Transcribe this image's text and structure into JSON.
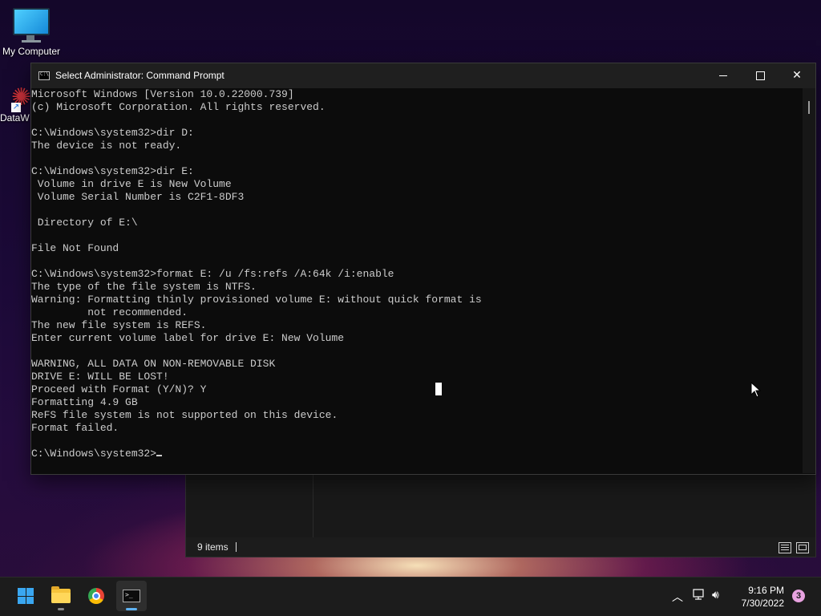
{
  "desktop": {
    "icons": [
      {
        "label": "My Computer"
      },
      {
        "label": "DataW"
      }
    ]
  },
  "explorer": {
    "status_items": "9 items"
  },
  "cmd": {
    "title": "Select Administrator: Command Prompt",
    "lines": [
      "Microsoft Windows [Version 10.0.22000.739]",
      "(c) Microsoft Corporation. All rights reserved.",
      "",
      "C:\\Windows\\system32>dir D:",
      "The device is not ready.",
      "",
      "C:\\Windows\\system32>dir E:",
      " Volume in drive E is New Volume",
      " Volume Serial Number is C2F1-8DF3",
      "",
      " Directory of E:\\",
      "",
      "File Not Found",
      "",
      "C:\\Windows\\system32>format E: /u /fs:refs /A:64k /i:enable",
      "The type of the file system is NTFS.",
      "Warning: Formatting thinly provisioned volume E: without quick format is",
      "         not recommended.",
      "The new file system is REFS.",
      "Enter current volume label for drive E: New Volume",
      "",
      "WARNING, ALL DATA ON NON-REMOVABLE DISK",
      "DRIVE E: WILL BE LOST!",
      "Proceed with Format (Y/N)? Y",
      "Formatting 4.9 GB",
      "ReFS file system is not supported on this device.",
      "Format failed.",
      ""
    ],
    "prompt": "C:\\Windows\\system32>"
  },
  "taskbar": {
    "apps": [
      "start-icon",
      "file-explorer-icon",
      "chrome-icon",
      "command-prompt-icon"
    ],
    "time": "9:16 PM",
    "date": "7/30/2022",
    "notifications": "3"
  },
  "colors": {
    "console_bg": "#0c0c0c",
    "console_text": "#cccccc",
    "accent": "#3aa7f1"
  }
}
